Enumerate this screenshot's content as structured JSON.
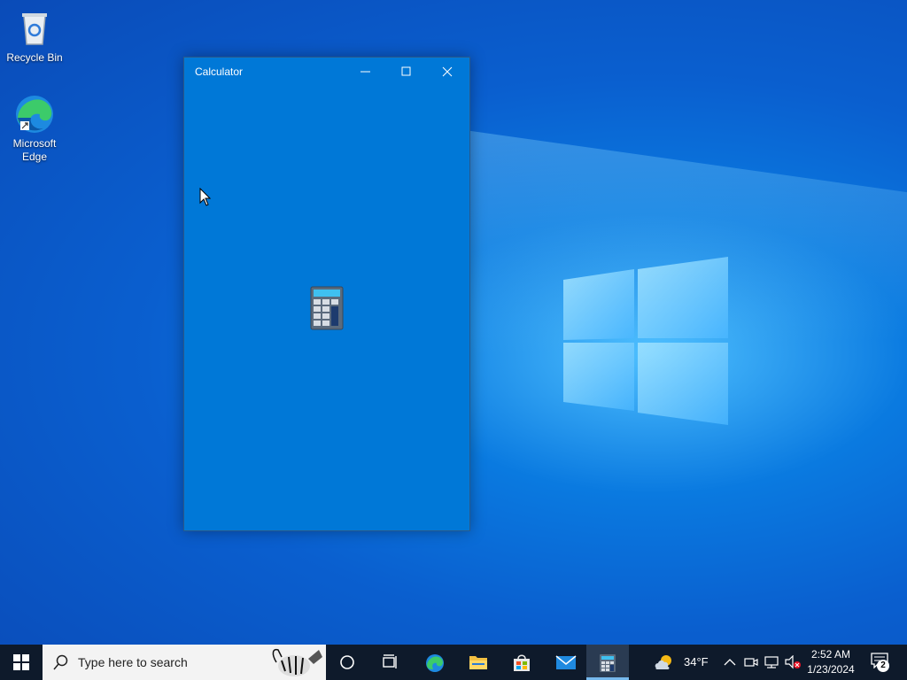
{
  "desktop": {
    "icons": [
      {
        "label": "Recycle Bin"
      },
      {
        "label": "Microsoft\nEdge"
      }
    ]
  },
  "window": {
    "title": "Calculator",
    "controls": {
      "minimize": "minimize",
      "maximize": "maximize",
      "close": "close"
    }
  },
  "taskbar": {
    "search_placeholder": "Type here to search",
    "pinned": [
      "cortana-icon",
      "task-view-icon",
      "edge-icon",
      "file-explorer-icon",
      "store-icon",
      "mail-icon",
      "calculator-icon"
    ],
    "weather_temp": "34°F",
    "time": "2:52 AM",
    "date": "1/23/2024",
    "notification_count": "2"
  },
  "colors": {
    "window_bg": "#0078d7",
    "taskbar_bg": "#0e1a2b",
    "accent": "#76b9ed"
  }
}
